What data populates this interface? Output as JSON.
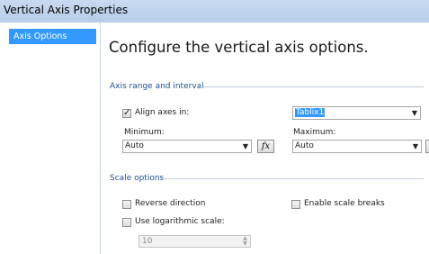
{
  "window": {
    "title": "Vertical Axis Properties"
  },
  "nav": {
    "items": [
      {
        "label": "Axis Options"
      }
    ]
  },
  "main": {
    "heading": "Configure the vertical axis options.",
    "axis_range": {
      "section_title": "Axis range and interval",
      "align_axes": {
        "label": "Align axes  in:",
        "checked": true
      },
      "align_target": "Tablix1",
      "minimum": {
        "label": "Minimum:",
        "value": "Auto"
      },
      "maximum": {
        "label": "Maximum:",
        "value": "Auto"
      },
      "fx_label": "fx"
    },
    "scale": {
      "section_title": "Scale options",
      "reverse": {
        "label": "Reverse direction",
        "checked": false
      },
      "scale_breaks": {
        "label": "Enable scale breaks",
        "checked": false
      },
      "log_scale": {
        "label": "Use logarithmic scale:",
        "checked": false
      },
      "log_base": "10"
    }
  },
  "icons": {
    "check": "checkmark-icon",
    "dropdown": "chevron-down-icon",
    "expression": "fx-icon"
  }
}
